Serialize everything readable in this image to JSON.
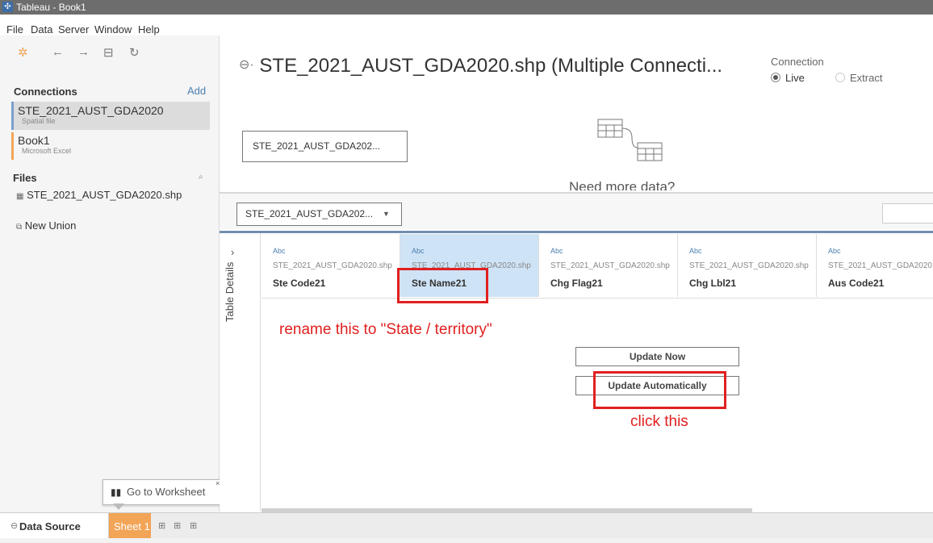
{
  "window": {
    "title": "Tableau - Book1"
  },
  "menu": [
    "File",
    "Data",
    "Server",
    "Window",
    "Help"
  ],
  "connections": {
    "header": "Connections",
    "add_label": "Add",
    "items": [
      {
        "name": "STE_2021_AUST_GDA2020",
        "type": "Spatial file"
      },
      {
        "name": "Book1",
        "type": "Microsoft Excel"
      }
    ]
  },
  "files": {
    "header": "Files",
    "items": [
      "STE_2021_AUST_GDA2020.shp"
    ],
    "new_union": "New Union"
  },
  "datasource": {
    "title": "STE_2021_AUST_GDA2020.shp (Multiple Connecti...",
    "connection_label": "Connection",
    "live_label": "Live",
    "extract_label": "Extract",
    "canvas_table": "STE_2021_AUST_GDA202...",
    "need_more_data": "Need more data?",
    "table_dropdown": "STE_2021_AUST_GDA202..."
  },
  "table_details_label": "Table Details",
  "columns": [
    {
      "type": "Abc",
      "source": "STE_2021_AUST_GDA2020.shp",
      "name": "Ste Code21"
    },
    {
      "type": "Abc",
      "source": "STE_2021_AUST_GDA2020.shp",
      "name": "Ste Name21"
    },
    {
      "type": "Abc",
      "source": "STE_2021_AUST_GDA2020.shp",
      "name": "Chg Flag21"
    },
    {
      "type": "Abc",
      "source": "STE_2021_AUST_GDA2020.shp",
      "name": "Chg Lbl21"
    },
    {
      "type": "Abc",
      "source": "STE_2021_AUST_GDA2020.",
      "name": "Aus Code21"
    }
  ],
  "buttons": {
    "update_now": "Update Now",
    "update_auto": "Update Automatically"
  },
  "annotations": {
    "rename_note": "rename this to \"State / territory\"",
    "click_note": "click this"
  },
  "tooltip": {
    "go_to_worksheet": "Go to Worksheet"
  },
  "bottom_tabs": {
    "data_source": "Data Source",
    "sheet1": "Sheet 1"
  },
  "colors": {
    "accent_orange": "#f2a457",
    "selected_col": "#cfe3f6",
    "annotation_red": "#e02020",
    "tab_blue": "#4a7fb0"
  }
}
